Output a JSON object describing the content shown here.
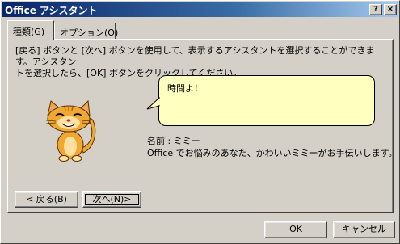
{
  "window": {
    "title": "Office アシスタント"
  },
  "titlebar_buttons": {
    "help": "?",
    "close": "×"
  },
  "tabs": [
    {
      "label": "種類(G)",
      "active": true
    },
    {
      "label": "オプション(O)",
      "active": false
    }
  ],
  "instruction": {
    "line1": "[戻る] ボタンと [次へ] ボタンを使用して、表示するアシスタントを選択することができます。アシスタン",
    "line2": "トを選択したら、[OK] ボタンをクリックしてください。"
  },
  "bubble": {
    "text": "時間よ！"
  },
  "assistant": {
    "name_label": "名前 :",
    "name": "ミミー",
    "description": "Office でお悩みのあなた、かわいいミミーがお手伝いします。"
  },
  "nav": {
    "back_label": "< 戻る(B)",
    "next_label": "次へ(N)>"
  },
  "footer": {
    "ok_label": "OK",
    "cancel_label": "キャンセル"
  },
  "colors": {
    "face": "#d4d0c8",
    "bubble": "#ffffc0",
    "title_start": "#0a246a",
    "title_end": "#a6caf0"
  }
}
